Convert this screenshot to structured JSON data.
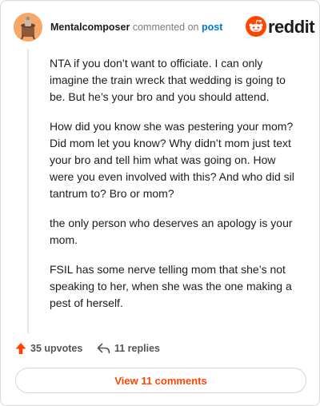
{
  "header": {
    "author": "Mentalcomposer",
    "verb": "commented on",
    "post_link": "post",
    "logo_text": "reddit"
  },
  "comment": {
    "paragraphs": [
      "NTA if you don’t want to officiate. I can only imagine the train wreck that wedding is going to be. But he’s your bro and you should attend.",
      "How did you know she was pestering your mom? Did mom let you know? Why didn’t mom just text your bro and tell him what was going on. How were you even involved with this? And who did sil tantrum to? Bro or mom?",
      "the only person who deserves an apology is your mom.",
      "FSIL has some nerve telling mom that she’s not speaking to her, when she was the one making a pest of herself."
    ]
  },
  "actions": {
    "upvotes_label": "35 upvotes",
    "replies_label": "11 replies"
  },
  "footer": {
    "view_comments_label": "View 11 comments"
  },
  "colors": {
    "brand": "#ff4500",
    "link": "#0079d3"
  },
  "icons": {
    "upvote": "upvote-arrow-icon",
    "reply": "reply-arrow-icon",
    "logo": "reddit-snoo-icon"
  }
}
